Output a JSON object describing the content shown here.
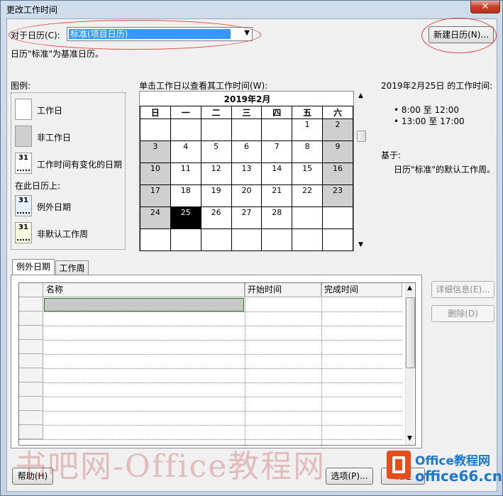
{
  "window": {
    "title": "更改工作时间",
    "close_symbol": "✕"
  },
  "calendar_selector": {
    "label": "对于日历(C):",
    "value": "标准(项目日历)",
    "new_button": "新建日历(N)...",
    "base_note": "日历\"标准\"为基准日历。"
  },
  "legend": {
    "title": "图例:",
    "items": [
      {
        "label": "工作日",
        "swatch": "white"
      },
      {
        "label": "非工作日",
        "swatch": "gray"
      },
      {
        "label": "工作时间有变化的日期",
        "swatch": "31"
      }
    ],
    "subtitle": "在此日历上:",
    "items2": [
      {
        "label": "例外日期",
        "swatch": "31"
      },
      {
        "label": "非默认工作周",
        "swatch": "31"
      }
    ]
  },
  "calendar": {
    "instruction": "单击工作日以查看其工作时间(W):",
    "month_title": "2019年2月",
    "weekdays": [
      "日",
      "一",
      "二",
      "三",
      "四",
      "五",
      "六"
    ],
    "weeks": [
      [
        "",
        "",
        "",
        "",
        "",
        "1",
        "2"
      ],
      [
        "3",
        "4",
        "5",
        "6",
        "7",
        "8",
        "9"
      ],
      [
        "10",
        "11",
        "12",
        "13",
        "14",
        "15",
        "16"
      ],
      [
        "17",
        "18",
        "19",
        "20",
        "21",
        "22",
        "23"
      ],
      [
        "24",
        "25",
        "26",
        "27",
        "28",
        "",
        ""
      ],
      [
        "",
        "",
        "",
        "",
        "",
        "",
        ""
      ]
    ],
    "selected_day": "25"
  },
  "working_time": {
    "heading": "2019年2月25日 的工作时间:",
    "slots": [
      "• 8:00 至 12:00",
      "• 13:00 至 17:00"
    ],
    "based_on_label": "基于:",
    "based_on_text": "日历\"标准\"的默认工作周。"
  },
  "tabs": [
    {
      "label": "例外日期",
      "active": true
    },
    {
      "label": "工作周",
      "active": false
    }
  ],
  "exceptions_table": {
    "columns": [
      "名称",
      "开始时间",
      "完成时间"
    ]
  },
  "side_buttons": {
    "details": "详细信息(E)...",
    "delete": "删除(D)"
  },
  "footer": {
    "help": "帮助(H)",
    "options": "选项(P)...",
    "ok": "确定"
  },
  "watermark": "书吧网-Office教程网",
  "logo": {
    "brand": "Office教程网",
    "site": "office66.cn"
  }
}
